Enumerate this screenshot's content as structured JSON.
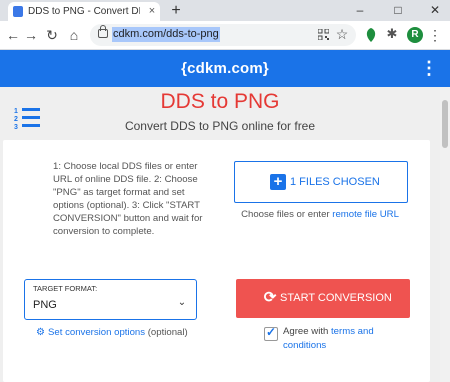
{
  "browser": {
    "tab_title": "DDS to PNG - Convert DDS to PN",
    "tab_close": "×",
    "new_tab": "+",
    "window_minimize": "–",
    "window_maximize": "□",
    "window_close": "✕",
    "url": "cdkm.com/dds-to-png",
    "avatar_initial": "R"
  },
  "site": {
    "brand": "{cdkm.com}"
  },
  "page": {
    "title": "DDS to PNG",
    "subtitle": "Convert DDS to PNG online for free",
    "instructions": "1: Choose local DDS files or enter URL of online DDS file. 2: Choose \"PNG\" as target format and set options (optional). 3: Click \"START CONVERSION\" button and wait for conversion to complete.",
    "choose_button_label": "1 FILES CHOSEN",
    "choose_hint_prefix": "Choose files or enter ",
    "choose_hint_link": "remote file URL",
    "target_format_label": "TARGET FORMAT:",
    "target_format_value": "PNG",
    "set_options_link": "Set conversion options",
    "set_options_suffix": " (optional)",
    "start_button_label": "START CONVERSION",
    "agree_prefix": "Agree with ",
    "agree_link": "terms and conditions"
  },
  "colors": {
    "brand_blue": "#1a73e8",
    "title_red": "#e53935",
    "start_button": "#ef5350"
  }
}
